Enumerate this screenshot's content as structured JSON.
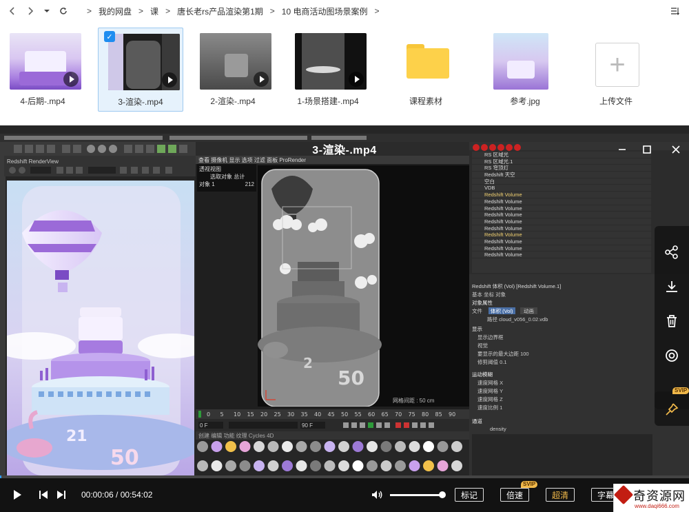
{
  "nav": {
    "breadcrumbs": [
      "我的网盘",
      "课",
      "唐长老rs产品渲染第1期",
      "10 电商活动图场景案例"
    ],
    "separator": ">"
  },
  "files": [
    {
      "name": "4-后期-.mp4",
      "type": "video",
      "selected": false
    },
    {
      "name": "3-渲染-.mp4",
      "type": "video",
      "selected": true
    },
    {
      "name": "2-渲染-.mp4",
      "type": "video",
      "selected": false
    },
    {
      "name": "1-场景搭建-.mp4",
      "type": "video",
      "selected": false
    },
    {
      "name": "课程素材",
      "type": "folder",
      "selected": false
    },
    {
      "name": "参考.jpg",
      "type": "image",
      "selected": false
    },
    {
      "name": "上传文件",
      "type": "upload",
      "selected": false
    }
  ],
  "player": {
    "title": "3-渲染-.mp4",
    "current_time": "00:00:06",
    "total_time": "00:54:02",
    "time_separator": " / ",
    "progress": 0.002,
    "volume": 1.0,
    "buttons": {
      "bookmark": "标记",
      "speed": "倍速",
      "quality": "超清",
      "subtitle": "字幕"
    },
    "badges": {
      "speed": "SVIP",
      "pin": "SVIP"
    },
    "side_actions": [
      "share-icon",
      "download-icon",
      "delete-icon",
      "circle-target-icon",
      "pin-icon"
    ]
  },
  "video_content": {
    "render_view_title": "Redshift RenderView",
    "viewport_tabs": "查看  摄像机  显示  选项  过滤  面板  ProRender",
    "viewport_label": "透视视图",
    "stats_header": "选取对象 总计",
    "stats_object_label": "对象 1",
    "stats_object_value": "212",
    "grid_spacing": "网格间距 : 50 cm",
    "timeline_ticks": [
      "0",
      "5",
      "10",
      "15",
      "20",
      "25",
      "30",
      "35",
      "40",
      "45",
      "50",
      "55",
      "60",
      "65",
      "70",
      "75",
      "80",
      "85",
      "90"
    ],
    "frame_start": "0 F",
    "frame_end": "90 F",
    "material_tabs": "创建  编辑  功能  纹理  Cycles 4D",
    "object_list": [
      "RS 区域光",
      "RS 区域光.1",
      "RS 穹顶灯",
      "Redshift 天空",
      "空白",
      "VDB",
      "Redshift Volume",
      "Redshift Volume",
      "Redshift Volume",
      "Redshift Volume",
      "Redshift Volume",
      "Redshift Volume",
      "Redshift Volume",
      "Redshift Volume",
      "Redshift Volume",
      "Redshift Volume"
    ],
    "attr_title": "Redshift 体积 (Vol) [Redshift Volume.1]",
    "attr_tabs": "基本  坐标  对象",
    "attr_section": "对象属性",
    "attr_file_label": "文件",
    "attr_file_tab": "体积 (Vol)",
    "attr_anim_tab": "动画",
    "attr_path": "路径  cloud_v056_0.02.vdb",
    "attr_display": "显示",
    "attr_rows": [
      "显示边界框",
      "视觉",
      "要显示的最大边距  100",
      "修剪阈值  0.1"
    ],
    "attr_motion": "运动模糊",
    "attr_motion_rows": [
      "速度网格 X",
      "速度网格 Y",
      "速度网格 Z",
      "速度比例  1"
    ],
    "attr_channel": "通道",
    "attr_channel_value": "density",
    "watermark_mid": "www.daqi666.com"
  },
  "watermark": {
    "text": "奇资源网",
    "sub": "www.daqi666.com"
  }
}
